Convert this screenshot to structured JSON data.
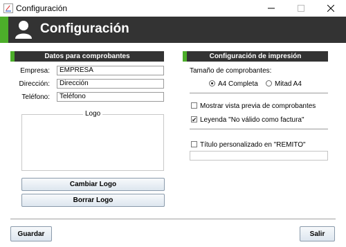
{
  "window": {
    "title": "Configuración",
    "minimize_icon": "minimize-icon",
    "maximize_icon": "maximize-icon",
    "close_icon": "close-icon"
  },
  "header": {
    "title": "Configuración",
    "icon": "user-icon",
    "accent_color": "#4cae2a",
    "bg_color": "#333333"
  },
  "left_section": {
    "title": "Datos para comprobantes",
    "fields": [
      {
        "label": "Empresa:",
        "value": "EMPRESA"
      },
      {
        "label": "Dirección:",
        "value": "Dirección"
      },
      {
        "label": "Teléfono:",
        "value": "Teléfono"
      }
    ],
    "logo_label": "Logo",
    "change_logo": "Cambiar Logo",
    "delete_logo": "Borrar Logo"
  },
  "right_section": {
    "title": "Configuración de impresión",
    "size_label": "Tamaño de comprobantes:",
    "options": [
      {
        "label": "A4 Completa",
        "selected": true
      },
      {
        "label": "Mitad A4",
        "selected": false
      }
    ],
    "checkboxes": [
      {
        "label": "Mostrar vista previa de comprobantes",
        "checked": false
      },
      {
        "label": "Leyenda \"No válido como factura\"",
        "checked": true
      },
      {
        "label": "Título personalizado en \"REMITO\"",
        "checked": false
      }
    ],
    "custom_title_value": ""
  },
  "footer": {
    "save": "Guardar",
    "exit": "Salir"
  }
}
